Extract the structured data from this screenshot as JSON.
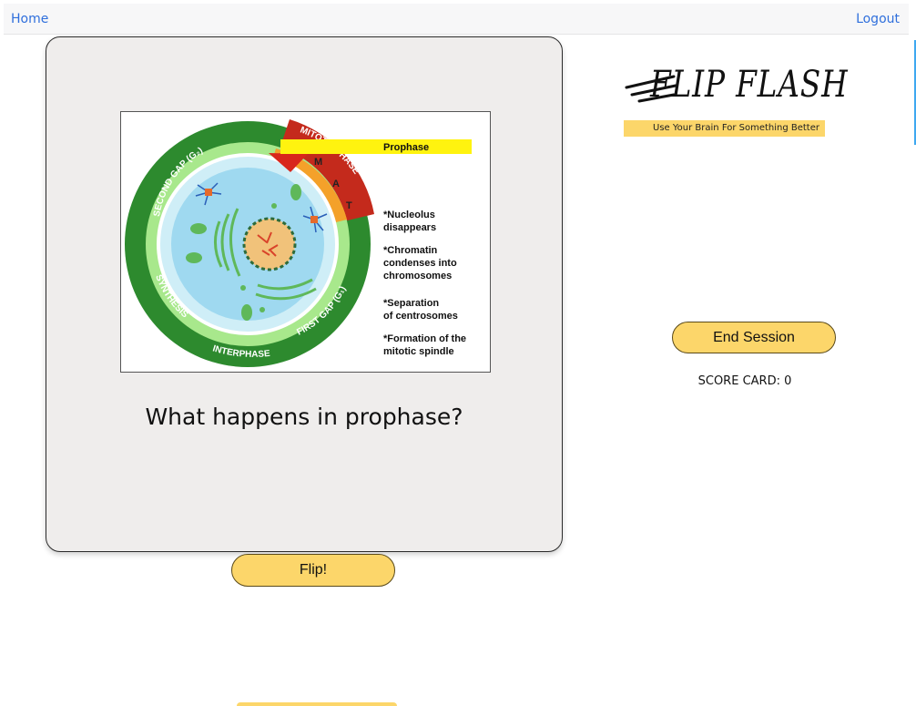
{
  "nav": {
    "home_label": "Home",
    "logout_label": "Logout"
  },
  "logo": {
    "title": "FLIP FLASH",
    "tagline": "Use Your Brain For Something Better"
  },
  "card": {
    "question": "What happens in prophase?",
    "image": {
      "highlight_label": "Prophase",
      "notes": [
        [
          "*Nucleolus",
          " disappears"
        ],
        [
          "*Chromatin",
          "condenses into",
          "chromosomes"
        ],
        [
          "*Separation",
          "of centrosomes"
        ],
        [
          "*Formation of the",
          "mitotic spindle"
        ]
      ],
      "ring_labels": {
        "second_gap": "SECOND GAP (G₂)",
        "mitotic_phase": "MITOTIC PHASE",
        "phase_letters": [
          "M",
          "A",
          "T"
        ],
        "synthesis": "SYNTHESIS",
        "first_gap": "FIRST GAP (G₁)",
        "interphase": "INTERPHASE"
      }
    }
  },
  "controls": {
    "flip_label": "Flip!",
    "end_session_label": "End Session"
  },
  "score": {
    "text": "SCORE CARD: 0"
  },
  "colors": {
    "button": "#fcd66a",
    "link": "#2f6fdc",
    "card_bg": "#efedec"
  }
}
